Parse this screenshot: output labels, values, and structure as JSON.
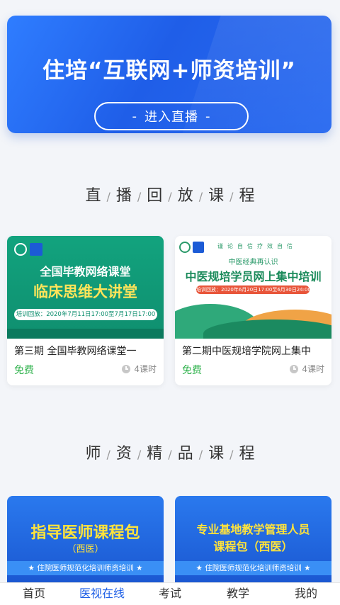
{
  "banner": {
    "title": "住培“互联网+师资培训”",
    "button": "进入直播",
    "button_dash": "-"
  },
  "section_replay": {
    "chars": [
      "直",
      "播",
      "回",
      "放",
      "课",
      "程"
    ],
    "separator": "/"
  },
  "replay_courses": [
    {
      "thumb_line1": "全国毕教网络课堂",
      "thumb_line2": "临床思维大讲堂",
      "thumb_date": "培训回放：2020年7月11日17:00至7月17日17:00",
      "title": "第三期 全国毕教网络课堂一",
      "price": "免费",
      "lessons": "4课时"
    },
    {
      "thumb_motto": "谨论自信疗效自信",
      "thumb_sub": "中医经典再认识",
      "thumb_main": "中医规培学员网上集中培训",
      "thumb_date": "培训回放：2020年6月20日17:00至6月30日24:00",
      "title": "第二期中医规培学院网上集中",
      "price": "免费",
      "lessons": "4课时"
    }
  ],
  "section_teacher": {
    "chars": [
      "师",
      "资",
      "精",
      "品",
      "课",
      "程"
    ],
    "separator": "/"
  },
  "teacher_courses": [
    {
      "title": "指导医师课程包",
      "subtitle": "（西医）",
      "strip": "★ 住院医师规范化培训师资培训 ★"
    },
    {
      "title_line1": "专业基地教学管理人员",
      "title_line2": "课程包（西医）",
      "strip": "★ 住院医师规范化培训师资培训 ★"
    }
  ],
  "tabs": [
    {
      "label": "首页",
      "active": false
    },
    {
      "label": "医视在线",
      "active": true
    },
    {
      "label": "考试",
      "active": false
    },
    {
      "label": "教学",
      "active": false
    },
    {
      "label": "我的",
      "active": false
    }
  ],
  "colors": {
    "brand_blue": "#1e5fe6",
    "price_green": "#2fb24c",
    "course_yellow": "#ffe33b"
  }
}
